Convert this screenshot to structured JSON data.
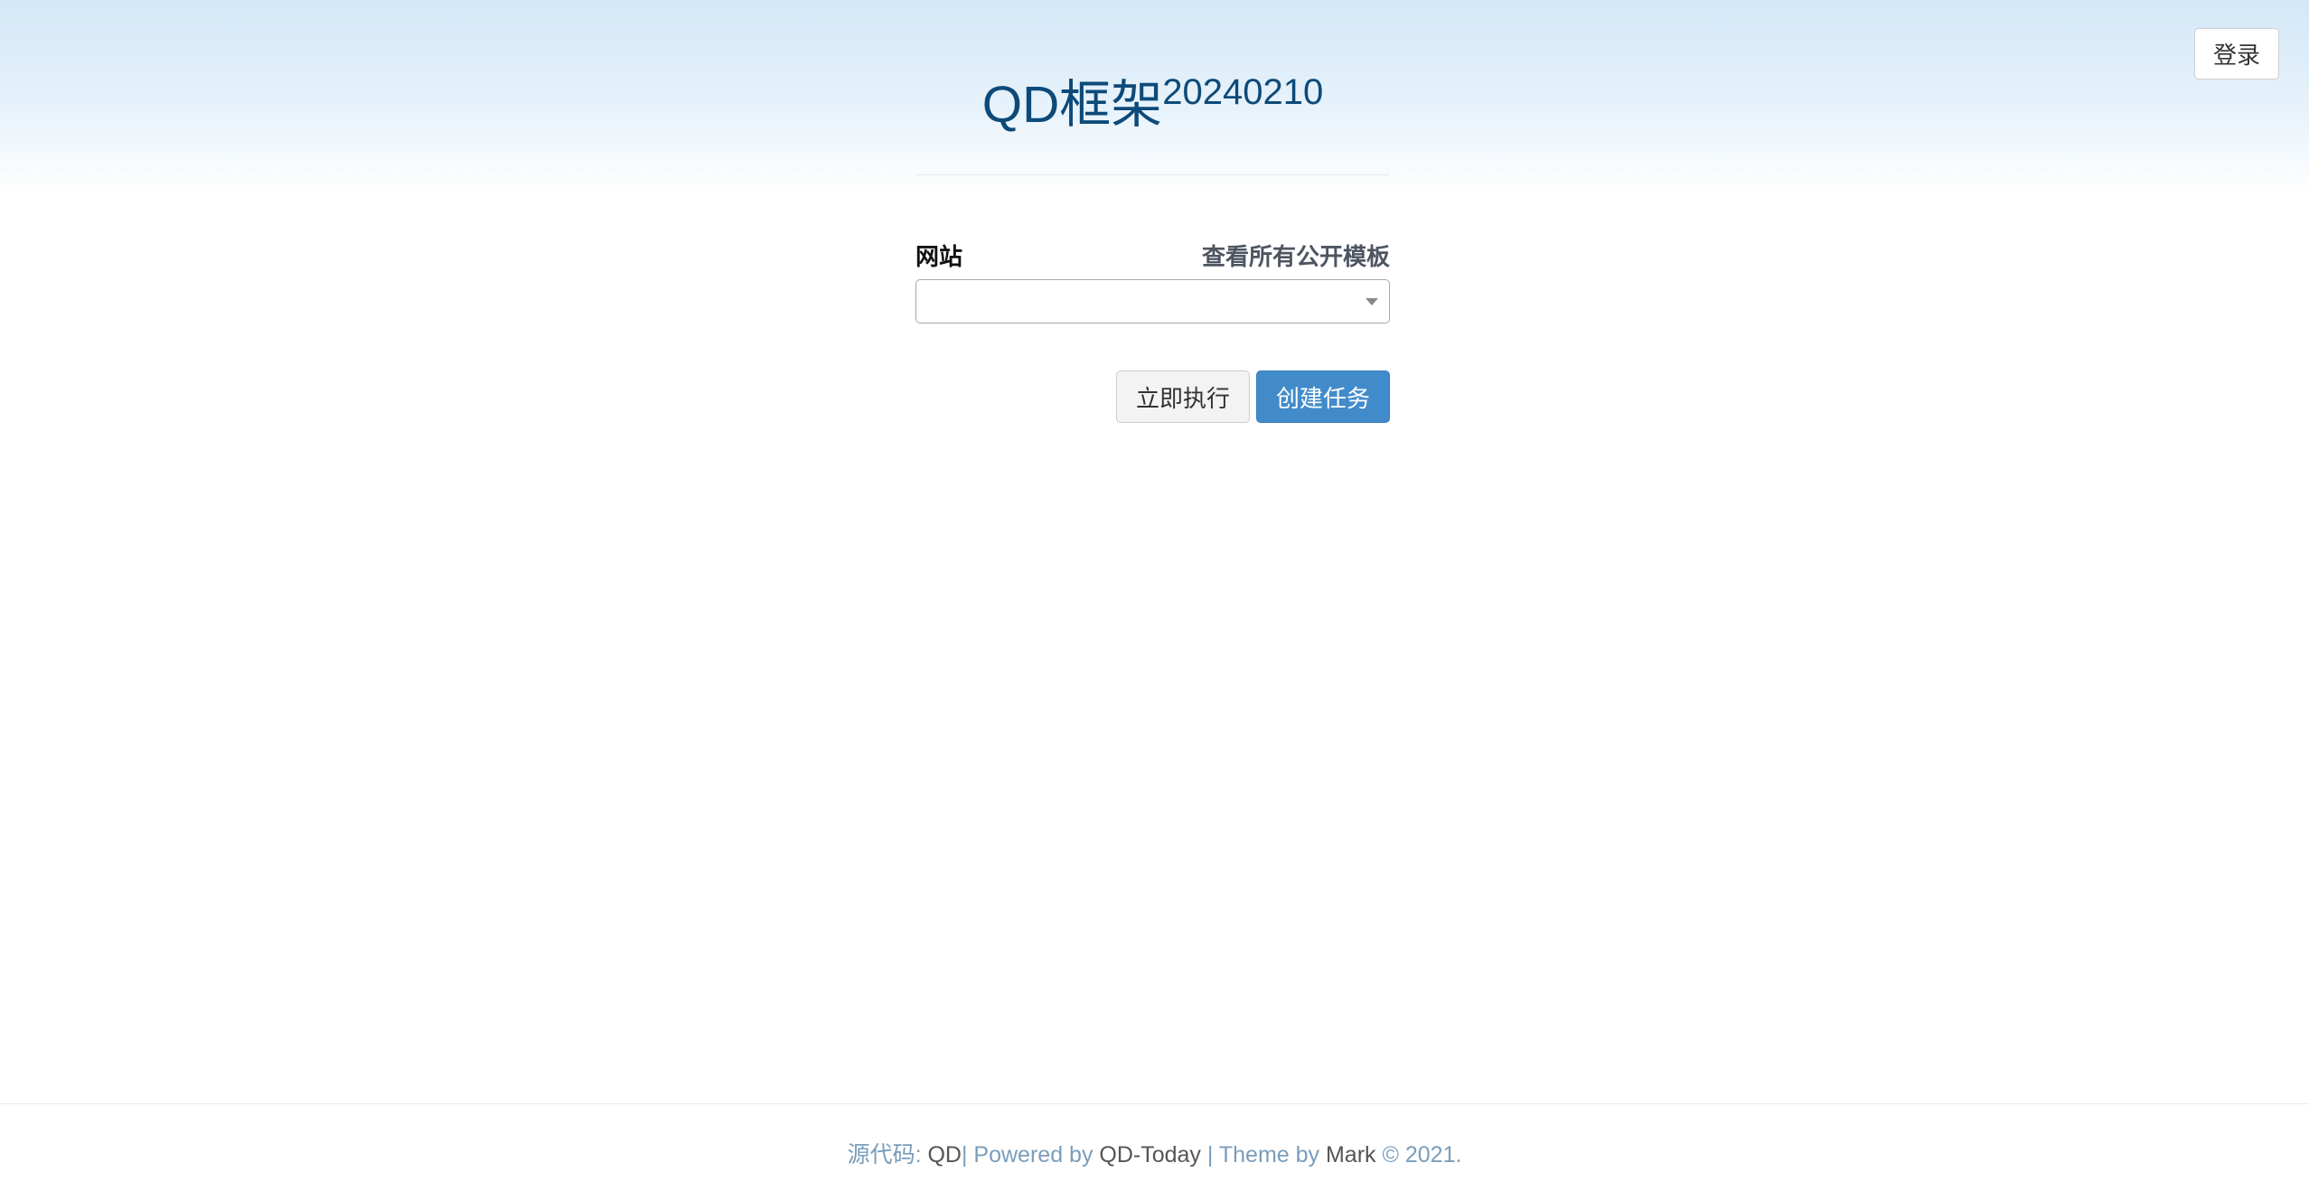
{
  "header": {
    "title": "QD框架",
    "version": "20240210",
    "login_label": "登录"
  },
  "form": {
    "site_label": "网站",
    "templates_link": "查看所有公开模板",
    "site_select_value": "",
    "run_now_label": "立即执行",
    "create_task_label": "创建任务"
  },
  "footer": {
    "source_prefix": "源代码: ",
    "source_link": "QD",
    "powered_prefix": "| Powered by ",
    "powered_link": "QD-Today",
    "theme_prefix": " | Theme by ",
    "theme_link": "Mark",
    "copyright": " © 2021."
  },
  "colors": {
    "title": "#0d4a79",
    "primary_button": "#428bca",
    "footer_text": "#7a9dbb",
    "header_gradient_top": "#d3e8f8"
  },
  "icons": {
    "select_caret": "chevron-down-icon"
  }
}
